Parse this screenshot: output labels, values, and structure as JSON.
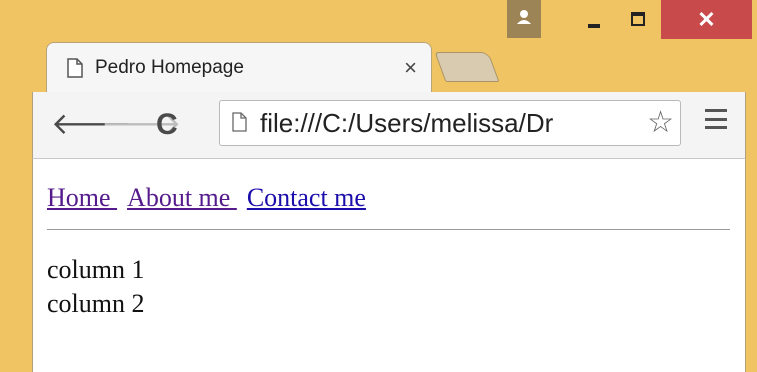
{
  "tab": {
    "title": "Pedro Homepage",
    "close_glyph": "×"
  },
  "toolbar": {
    "url": "file:///C:/Users/melissa/Dr"
  },
  "nav_links": [
    {
      "label": "Home "
    },
    {
      "label": "About me "
    },
    {
      "label": "Contact me"
    }
  ],
  "columns": [
    "column 1",
    "column 2"
  ],
  "colors": {
    "frame": "#f0c462",
    "close": "#c94a4a",
    "visited_link": "#551a8b",
    "link": "#1a0dab"
  }
}
